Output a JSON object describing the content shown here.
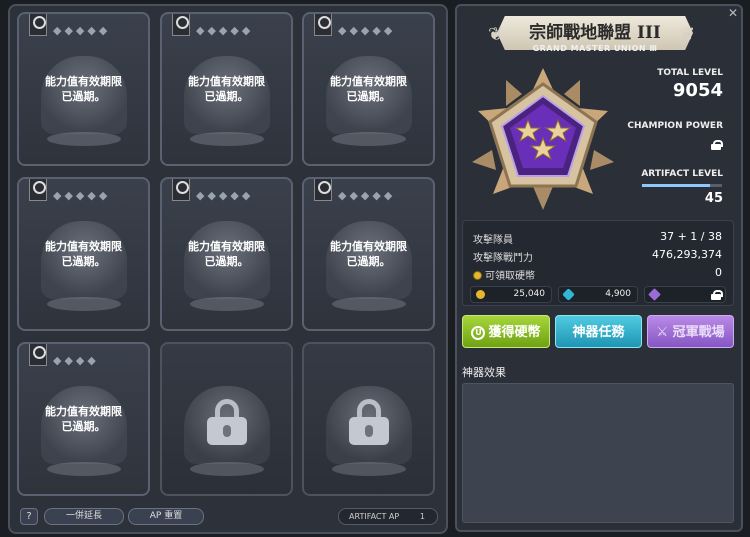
{
  "artifacts": [
    {
      "status": "expired",
      "stars": "◆◆◆◆◆",
      "text": "能力值有效期限\n已過期。"
    },
    {
      "status": "expired",
      "stars": "◆◆◆◆◆",
      "text": "能力值有效期限\n已過期。"
    },
    {
      "status": "expired",
      "stars": "◆◆◆◆◆",
      "text": "能力值有效期限\n已過期。"
    },
    {
      "status": "expired",
      "stars": "◆◆◆◆◆",
      "text": "能力值有效期限\n已過期。"
    },
    {
      "status": "expired",
      "stars": "◆◆◆◆◆",
      "text": "能力值有效期限\n已過期。"
    },
    {
      "status": "expired",
      "stars": "◆◆◆◆◆",
      "text": "能力值有效期限\n已過期。"
    },
    {
      "status": "expired",
      "stars": "◆◆◆◆",
      "text": "能力值有效期限\n已過期。"
    },
    {
      "status": "locked",
      "stars": "",
      "text": ""
    },
    {
      "status": "locked",
      "stars": "",
      "text": ""
    }
  ],
  "bottom_bar": {
    "help_label": "?",
    "extend_label": "一併延長",
    "reset_label": "AP 重置",
    "artifact_ap_label": "ARTIFACT AP",
    "artifact_ap_value": "1"
  },
  "union": {
    "title": "宗師戰地聯盟",
    "rank_numeral": "III",
    "subtitle": "GRAND MASTER UNION Ⅲ",
    "total_level_label": "TOTAL LEVEL",
    "total_level_value": "9054",
    "champion_power_label": "CHAMPION POWER",
    "artifact_level_label": "ARTIFACT LEVEL",
    "artifact_level_value": "45",
    "artifact_level_progress": 0.85
  },
  "info": {
    "members_label": "攻擊隊員",
    "members_value": "37 + 1 / 38",
    "power_label": "攻擊隊戰鬥力",
    "power_value": "476,293,374",
    "coins_label": "可領取硬幣",
    "coins_value": "0",
    "resources": {
      "gold": "25,040",
      "cyan": "4,900"
    }
  },
  "actions": {
    "coins_button": "獲得硬幣",
    "quest_button": "神器任務",
    "champion_button": "冠軍戰場"
  },
  "effects": {
    "title": "神器效果"
  },
  "colors": {
    "green_button": "#8cc02a",
    "cyan_button": "#35b1cc",
    "purple_button": "#a070d6",
    "emblem_purple": "#6a2fb8"
  }
}
